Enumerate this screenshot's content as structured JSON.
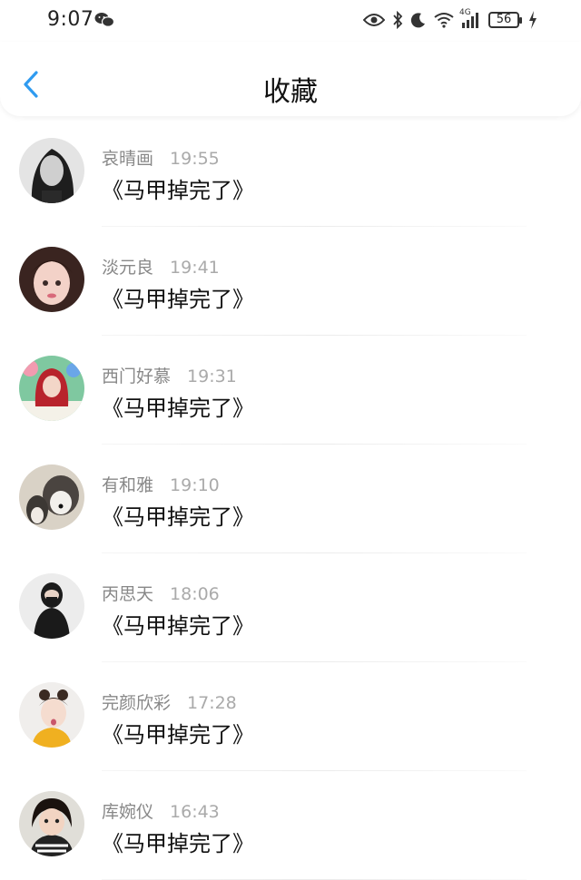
{
  "status_bar": {
    "time": "9:07",
    "network": "4G",
    "battery": "56",
    "icons": [
      "wechat-icon",
      "eye-icon",
      "bluetooth-icon",
      "moon-icon",
      "wifi-icon",
      "signal-icon",
      "battery-icon",
      "charging-icon"
    ]
  },
  "header": {
    "back_icon": "chevron-left-icon",
    "title": "收藏"
  },
  "favorites": [
    {
      "name": "哀晴画",
      "time": "19:55",
      "title": "《马甲掉完了》"
    },
    {
      "name": "淡元良",
      "time": "19:41",
      "title": "《马甲掉完了》"
    },
    {
      "name": "西门好慕",
      "time": "19:31",
      "title": "《马甲掉完了》"
    },
    {
      "name": "有和雅",
      "time": "19:10",
      "title": "《马甲掉完了》"
    },
    {
      "name": "丙思天",
      "time": "18:06",
      "title": "《马甲掉完了》"
    },
    {
      "name": "完颜欣彩",
      "time": "17:28",
      "title": "《马甲掉完了》"
    },
    {
      "name": "库婉仪",
      "time": "16:43",
      "title": "《马甲掉完了》"
    }
  ],
  "colors": {
    "accent": "#2f9bf0",
    "name_text": "#888888",
    "time_text": "#aaaaaa",
    "title_text": "#111111"
  }
}
